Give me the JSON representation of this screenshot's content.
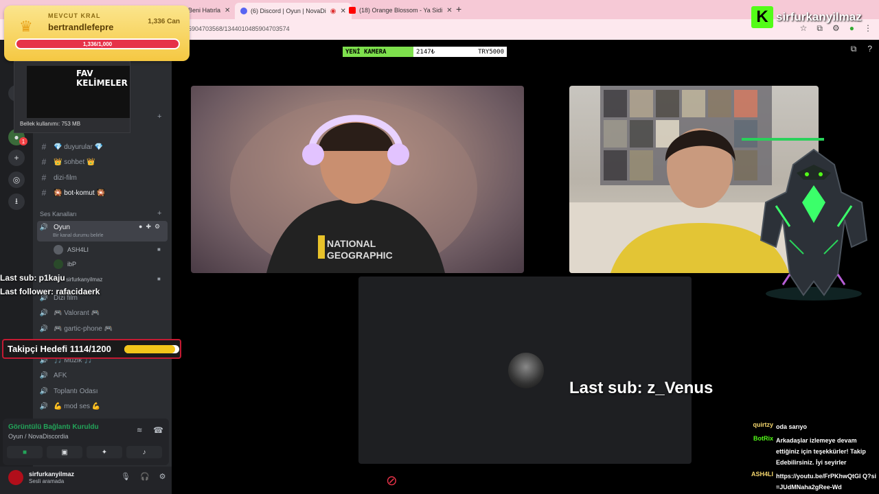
{
  "browser": {
    "tabs": [
      {
        "label": "Beni Hatırla",
        "color": "#888888"
      },
      {
        "label": "(6) Discord | Oyun | NovaDi",
        "color": "#5865f2"
      },
      {
        "label": "(18) Orange Blossom - Ya Sidi",
        "color": "#ff0000"
      }
    ],
    "url": "5904703568/1344010485904703574"
  },
  "overlay": {
    "kral_label": "MEVCUT KRAL",
    "kral_name": "bertrandlefepre",
    "kral_can": "1,336 Can",
    "kral_progress": "1,336/1,000",
    "brand_name": "sirfurkanyilmaz",
    "brand_letter": "K",
    "camera_label": "YENİ KAMERA",
    "camera_count": "2147₺",
    "camera_goal": "TRY5000",
    "last_sub_top": "Last sub: p1kaju",
    "last_follower": "Last follower: rafacidaerk",
    "goal_text": "Takipçi Hedefi 1114/1200",
    "goal_fraction": 0.928,
    "last_sub_big": "Last sub: z_Venus",
    "thumb_title": "FAV KELİMELER",
    "thumb_mem": "Bellek kullanımı: 753 MB"
  },
  "discord": {
    "channels": [
      {
        "label": "💎 duyurular 💎",
        "type": "text"
      },
      {
        "label": "👑 sohbet 👑",
        "type": "text"
      },
      {
        "label": "dizi-film",
        "type": "text"
      },
      {
        "label": "🎇 bot-komut 🎇",
        "type": "text"
      }
    ],
    "voice_category": "Ses Kanalları",
    "active_channel": "Oyun",
    "active_status": "Bir kanal durumu belirle",
    "members": [
      "ASH4LI",
      "ibP",
      "sirfurkanyilmaz"
    ],
    "voice_channels": [
      "Dizi film",
      "🎮 Valorant 🎮",
      "🎮 gartic-phone 🎮",
      "🎵 Müzik 🎵",
      "AFK",
      "Toplantı Odası",
      "💪 mod ses 💪"
    ],
    "voice_status": "Görüntülü Bağlantı Kuruldu",
    "voice_sub": "Oyun / NovaDiscordia",
    "user_name": "sirfurkanyilmaz",
    "user_state": "Sesli aramada",
    "server_badge": "1"
  },
  "chat": [
    {
      "user": "quirtzy",
      "color": "#f5d76e",
      "msg": "oda sarıyo"
    },
    {
      "user": "BotRix",
      "color": "#53fc18",
      "msg": "Arkadaşlar izlemeye devam ettiğiniz için teşekkürler! Takip Edebilirsiniz. İyi seyirler"
    },
    {
      "user": "ASH4LI",
      "color": "#f5d76e",
      "msg": "https://youtu.be/FrPKhwQtGI Q?si=JUdMNaha2gRee-Wd"
    }
  ],
  "colors": {
    "accent": "#53fc18",
    "discord_bg": "#2b2d31",
    "goal_border": "#c41a32"
  }
}
